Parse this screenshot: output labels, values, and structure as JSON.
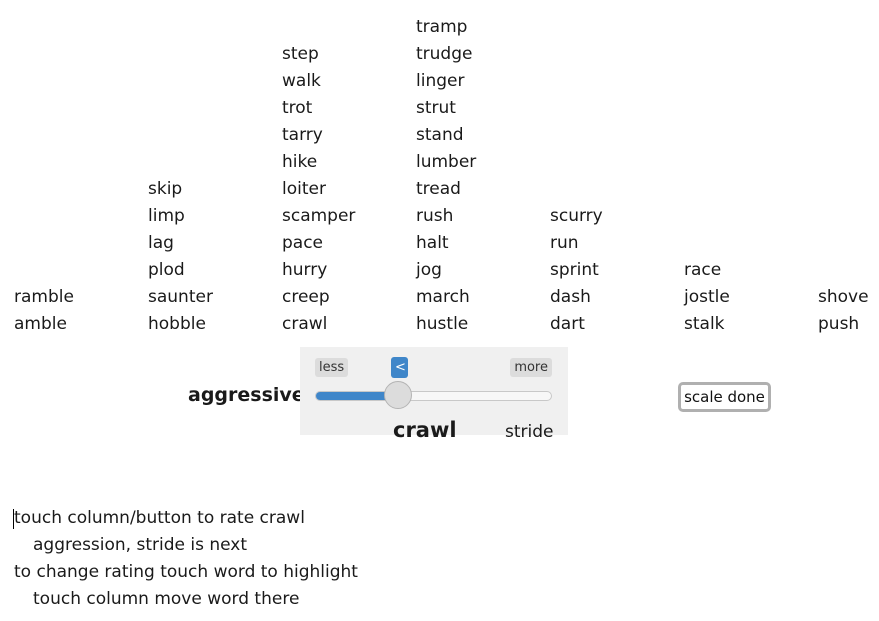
{
  "columns": [
    {
      "id": "col1",
      "words": [
        "ramble",
        "amble"
      ]
    },
    {
      "id": "col2",
      "words": [
        "skip",
        "limp",
        "lag",
        "plod",
        "saunter",
        "hobble"
      ]
    },
    {
      "id": "col3",
      "words": [
        "step",
        "walk",
        "trot",
        "tarry",
        "hike",
        "loiter",
        "scamper",
        "pace",
        "hurry",
        "creep",
        "crawl"
      ]
    },
    {
      "id": "col4",
      "words": [
        "tramp",
        "trudge",
        "linger",
        "strut",
        "stand",
        "lumber",
        "tread",
        "rush",
        "halt",
        "jog",
        "march",
        "hustle"
      ]
    },
    {
      "id": "col5",
      "words": [
        "scurry",
        "run",
        "sprint",
        "dash",
        "dart"
      ]
    },
    {
      "id": "col6",
      "words": [
        "race",
        "jostle",
        "stalk"
      ]
    },
    {
      "id": "col7",
      "words": [
        "shove",
        "push"
      ]
    }
  ],
  "slider": {
    "less_label": "less",
    "more_label": "more",
    "back_label": "<",
    "value_fraction": 0.35,
    "accent_color": "#3f86c9"
  },
  "scale_label": "aggressive",
  "current_word": "crawl",
  "next_word": "stride",
  "done_button_label": "scale done",
  "instructions": [
    "touch column/button to rate crawl",
    "aggression, stride is next",
    "to change rating touch word to highlight",
    "touch column move word there"
  ]
}
